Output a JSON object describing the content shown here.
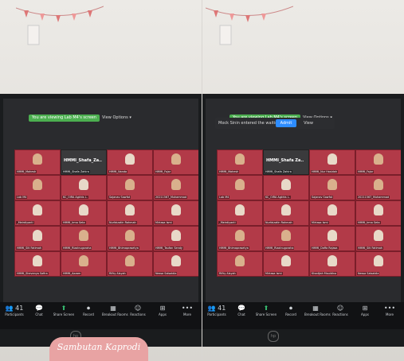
{
  "left": {
    "banner": "You are viewing Lab M4's screen",
    "view_options": "View Options ▾",
    "tiles": [
      {
        "name": "HMMI_Mahesh",
        "type": "person"
      },
      {
        "name": "HMMI_Shafa Zahira",
        "type": "dark",
        "label": "HMMI_Shafa_Za.."
      },
      {
        "name": "HMMI_Nanda",
        "type": "person",
        "hijab": true
      },
      {
        "name": "HMMI_Fajar",
        "type": "person"
      },
      {
        "name": "Lab M4",
        "type": "person"
      },
      {
        "name": "KC_OIRA Agkhis L.",
        "type": "person",
        "hijab": true
      },
      {
        "name": "Sajanav Sawfat",
        "type": "person"
      },
      {
        "name": "20211567_Muhammad",
        "type": "person"
      },
      {
        "name": "_Meirdiyanti",
        "type": "person",
        "hijab": true
      },
      {
        "name": "HMMI_Irma Seta",
        "type": "person",
        "hijab": true
      },
      {
        "name": "Nurfaizatin Rahmah",
        "type": "person",
        "hijab": true
      },
      {
        "name": "Mirtasa Ismi",
        "type": "person",
        "hijab": true
      },
      {
        "name": "HMMI_Siti Fatimah",
        "type": "person",
        "hijab": true
      },
      {
        "name": "HMMI_Rizalnugoraha",
        "type": "person"
      },
      {
        "name": "HMMI_Bhimaprasetya",
        "type": "person"
      },
      {
        "name": "HMMI_Taufan Sendy",
        "type": "person",
        "hijab": true
      },
      {
        "name": "HMMI_Shevanya Safira",
        "type": "person",
        "hijab": true
      },
      {
        "name": "HMMI_Azzam",
        "type": "person"
      },
      {
        "name": "Rifky Alsyah",
        "type": "person"
      },
      {
        "name": "Nessa Salsabila",
        "type": "person",
        "hijab": true
      }
    ],
    "toolbar": [
      {
        "label": "Participants",
        "icon": "👥",
        "count": "41"
      },
      {
        "label": "Chat",
        "icon": "💬"
      },
      {
        "label": "Share Screen",
        "icon": "⬆",
        "green": true
      },
      {
        "label": "Record",
        "icon": "⏺"
      },
      {
        "label": "Breakout Rooms",
        "icon": "▦"
      },
      {
        "label": "Reactions",
        "icon": "☺"
      },
      {
        "label": "Apps",
        "icon": "⊞"
      },
      {
        "label": "More",
        "icon": "•••"
      }
    ]
  },
  "right": {
    "banner": "You are viewing Lab M4's screen",
    "view_options": "View Options ▾",
    "notice": "Mock Sinin entered the waiting room",
    "admit_label": "Admit",
    "view_label": "View",
    "tiles": [
      {
        "name": "HMMI_Mahesh",
        "type": "person"
      },
      {
        "name": "HMMI_Shafa Zahira",
        "type": "dark",
        "label": "HMMI_Shafa Za.."
      },
      {
        "name": "HMMI_Nur Hasidah",
        "type": "person",
        "hijab": true
      },
      {
        "name": "HMMI_Fajar",
        "type": "person"
      },
      {
        "name": "Lab M4",
        "type": "person"
      },
      {
        "name": "KC_OIRA Agkhis L.",
        "type": "person",
        "hijab": true
      },
      {
        "name": "Sajanav Sawfat",
        "type": "person"
      },
      {
        "name": "20211567_Muhammad",
        "type": "person"
      },
      {
        "name": "_Meirdiyanti",
        "type": "person",
        "hijab": true
      },
      {
        "name": "Nurfaizatin Rahmah",
        "type": "person",
        "hijab": true
      },
      {
        "name": "Mirtasa Ismi",
        "type": "person",
        "hijab": true
      },
      {
        "name": "HMMI_Irma Seta",
        "type": "person",
        "hijab": true
      },
      {
        "name": "HMMI_Bhimaprasetya",
        "type": "person"
      },
      {
        "name": "HMMI_Rizalnugoraha",
        "type": "person"
      },
      {
        "name": "HMMI_Daffa Rajasa",
        "type": "person",
        "hijab": true
      },
      {
        "name": "HMMI_Siti Fatimah",
        "type": "person",
        "hijab": true
      },
      {
        "name": "Rifky Alsyah",
        "type": "person"
      },
      {
        "name": "Mirtasa Ismi",
        "type": "person",
        "hijab": true
      },
      {
        "name": "Khadijah Mauldina",
        "type": "person",
        "hijab": true
      },
      {
        "name": "Nessa Salsabila",
        "type": "person",
        "hijab": true
      }
    ],
    "toolbar": [
      {
        "label": "Participants",
        "icon": "👥",
        "count": "41"
      },
      {
        "label": "Chat",
        "icon": "💬"
      },
      {
        "label": "Share Screen",
        "icon": "⬆",
        "green": true
      },
      {
        "label": "Record",
        "icon": "⏺"
      },
      {
        "label": "Breakout Rooms",
        "icon": "▦"
      },
      {
        "label": "Reactions",
        "icon": "☺"
      },
      {
        "label": "Apps",
        "icon": "⊞"
      },
      {
        "label": "More",
        "icon": "•••"
      }
    ]
  },
  "caption": "Sambutan Kaprodi",
  "laptop_logo": "hp"
}
